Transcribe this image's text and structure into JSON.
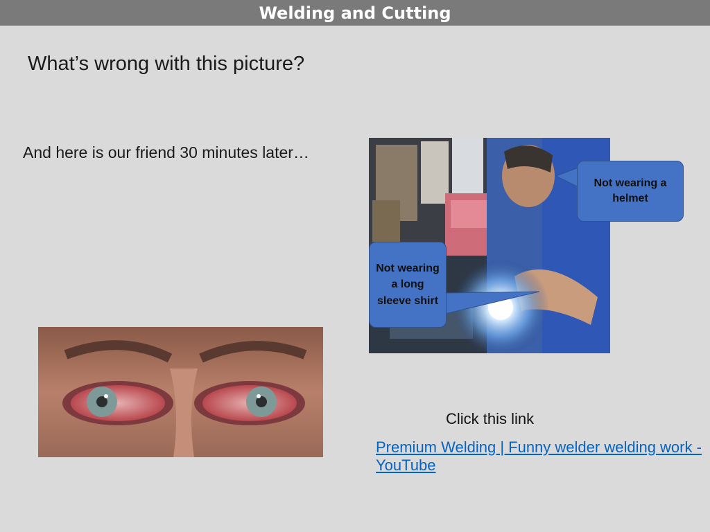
{
  "slide": {
    "title": "Welding and Cutting",
    "question": "What’s wrong with this picture?",
    "later_text": "And here is our friend 30 minutes later…",
    "callouts": {
      "helmet": "Not wearing a helmet",
      "sleeve": "Not wearing a long sleeve shirt"
    },
    "click_label": "Click this link",
    "link_text": "Premium Welding | Funny welder welding work - YouTube"
  },
  "colors": {
    "background": "#dadada",
    "title_bar": "#7a7a7a",
    "callout_fill": "#4472c4",
    "link": "#0563c1"
  }
}
